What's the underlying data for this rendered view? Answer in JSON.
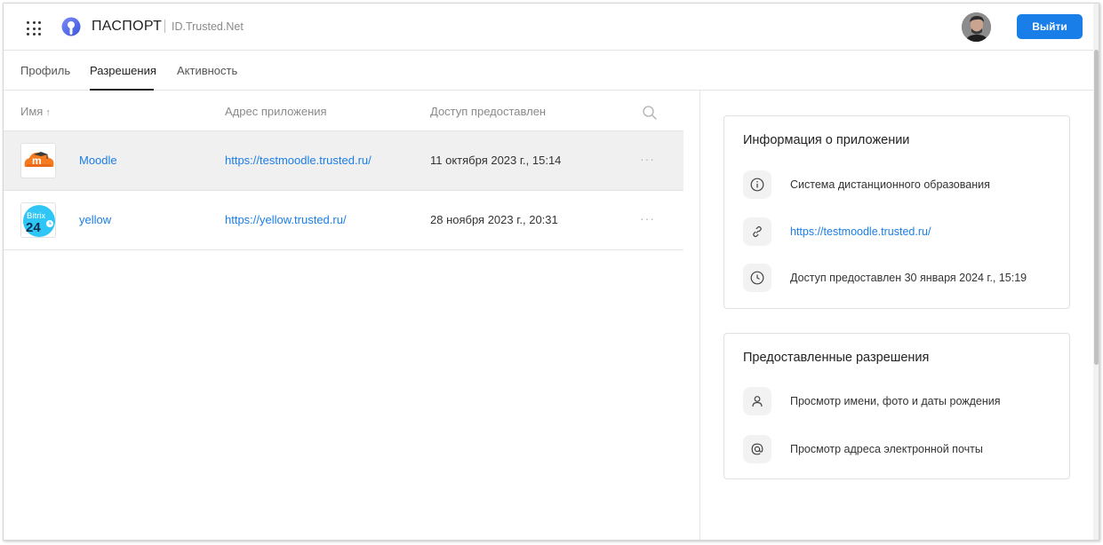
{
  "header": {
    "brand": "ПАСПОРТ",
    "domain": "ID.Trusted.Net",
    "logout_label": "Выйти",
    "icons": [
      "apps-grid-icon",
      "logo-icon",
      "avatar"
    ],
    "accent_color": "#1a7ee8"
  },
  "tabs": [
    {
      "label": "Профиль",
      "active": false
    },
    {
      "label": "Разрешения",
      "active": true
    },
    {
      "label": "Активность",
      "active": false
    }
  ],
  "table": {
    "headers": {
      "name": "Имя",
      "name_sort": "↑",
      "url": "Адрес приложения",
      "date": "Доступ предоставлен"
    },
    "rows": [
      {
        "name": "Moodle",
        "url": "https://testmoodle.trusted.ru/",
        "date": "11 октября 2023 г., 15:14",
        "menu": "···",
        "selected": true
      },
      {
        "name": "yellow",
        "icon_text_top": "Bitrix",
        "icon_text_bottom": "24",
        "url": "https://yellow.trusted.ru/",
        "date": "28 ноября 2023 г., 20:31",
        "menu": "···",
        "selected": false
      }
    ]
  },
  "app_info": {
    "title": "Информация о приложении",
    "description": "Система дистанционного образования",
    "url": "https://testmoodle.trusted.ru/",
    "access": "Доступ предоставлен 30 января 2024 г., 15:19"
  },
  "permissions": {
    "title": "Предоставленные разрешения",
    "items": [
      "Просмотр имени, фото и даты рождения",
      "Просмотр адреса электронной почты"
    ]
  }
}
